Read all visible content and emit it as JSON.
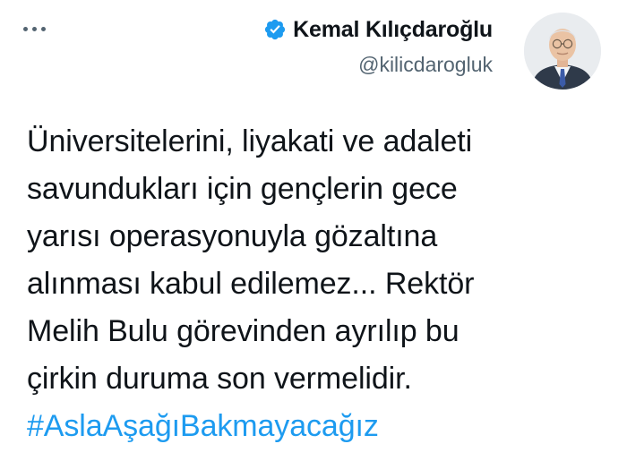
{
  "colors": {
    "text": "#0f1419",
    "secondary": "#536471",
    "link": "#1d9bf0",
    "background": "#ffffff"
  },
  "header": {
    "more_icon": "ellipsis-icon",
    "display_name": "Kemal Kılıçdaroğlu",
    "verified_icon": "verified-badge-icon",
    "handle": "@kilicdarogluk",
    "avatar": "profile-photo"
  },
  "tweet": {
    "lines": [
      "Üniversitelerini, liyakati ve adaleti",
      "savundukları için gençlerin gece",
      "yarısı operasyonuyla gözaltına",
      "alınması kabul edilemez... Rektör",
      "Melih Bulu görevinden ayrılıp bu",
      "çirkin duruma son vermelidir."
    ],
    "hashtag": "#AslaAşağıBakmayacağız"
  }
}
